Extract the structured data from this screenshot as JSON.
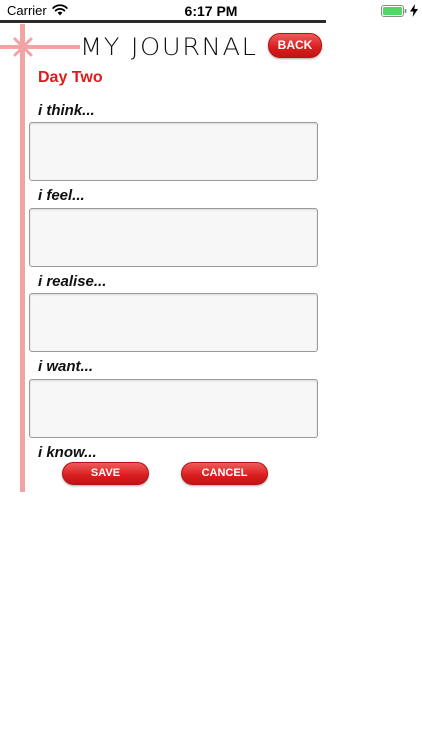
{
  "status_bar": {
    "carrier": "Carrier",
    "time": "6:17 PM",
    "icons": [
      "wifi-icon",
      "battery-icon",
      "charging-icon"
    ]
  },
  "header": {
    "title": "MY JOURNAL",
    "back_label": "BACK"
  },
  "entry": {
    "title": "Day Two",
    "prompts": [
      {
        "label": "i think...",
        "value": ""
      },
      {
        "label": "i feel...",
        "value": ""
      },
      {
        "label": "i realise...",
        "value": ""
      },
      {
        "label": "i want...",
        "value": ""
      },
      {
        "label": "i know..."
      }
    ]
  },
  "actions": {
    "save_label": "SAVE",
    "cancel_label": "CANCEL"
  },
  "colors": {
    "accent_red": "#e01b1b",
    "frame_pink": "#f2a3a3",
    "button_red": "#d81d1d"
  }
}
